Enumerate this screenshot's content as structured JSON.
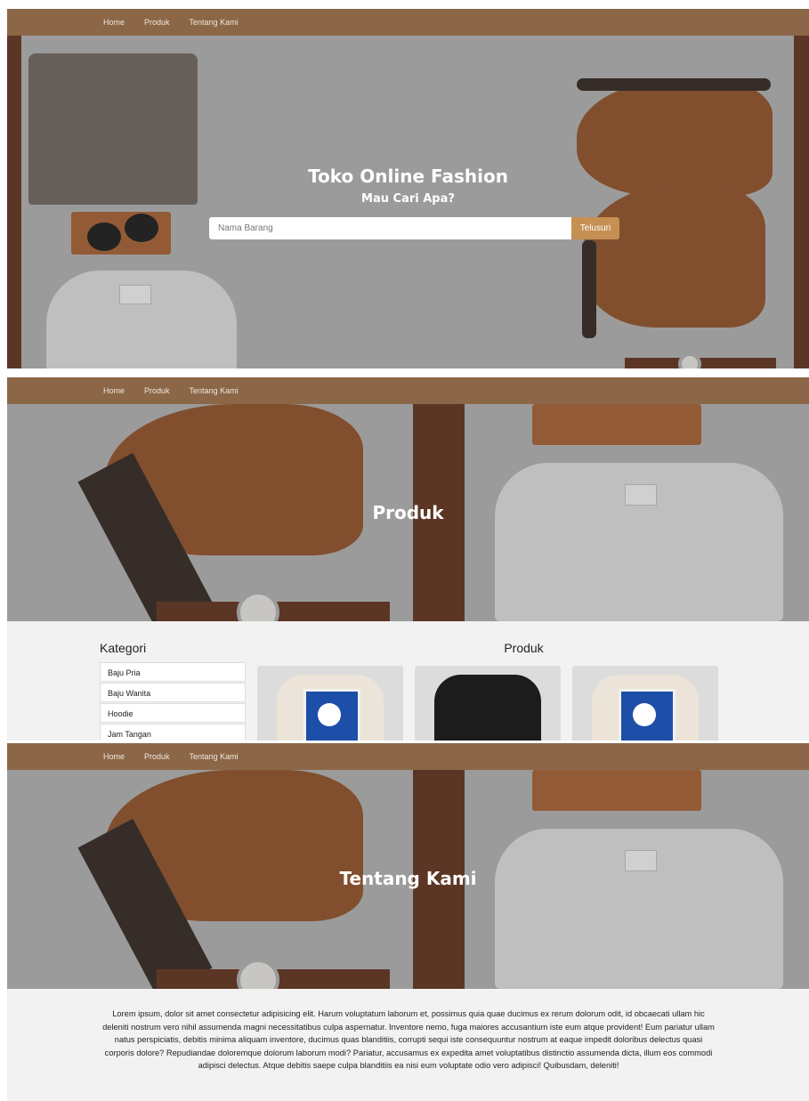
{
  "nav": {
    "home": "Home",
    "produk": "Produk",
    "tentang": "Tentang Kami"
  },
  "home": {
    "title": "Toko Online Fashion",
    "subtitle": "Mau Cari Apa?",
    "search_placeholder": "Nama Barang",
    "search_button": "Telusuri"
  },
  "produk": {
    "hero_title": "Produk",
    "kategori_title": "Kategori",
    "kategori_items": [
      "Baju Pria",
      "Baju Wanita",
      "Hoodie",
      "Jam Tangan"
    ],
    "produk_title": "Produk"
  },
  "tentang": {
    "hero_title": "Tentang Kami",
    "body": "Lorem ipsum, dolor sit amet consectetur adipisicing elit. Harum voluptatum laborum et, possimus quia quae ducimus ex rerum dolorum odit, id obcaecati ullam hic deleniti nostrum vero nihil assumenda magni necessitatibus culpa aspernatur. Inventore nemo, fuga maiores accusantium iste eum atque provident! Eum pariatur ullam natus perspiciatis, debitis minima aliquam inventore, ducimus quas blanditiis, corrupti sequi iste consequuntur nostrum at eaque impedit doloribus delectus quasi corporis dolore? Repudiandae doloremque dolorum laborum modi? Pariatur, accusamus ex expedita amet voluptatibus distinctio assumenda dicta, illum eos commodi adipisci delectus. Atque debitis saepe culpa blanditiis ea nisi eum voluptate odio vero adipisci! Quibusdam, deleniti!"
  },
  "colors": {
    "navbar": "#8b6748",
    "accent": "#c68f53",
    "section_bg": "#f2f2f2"
  }
}
